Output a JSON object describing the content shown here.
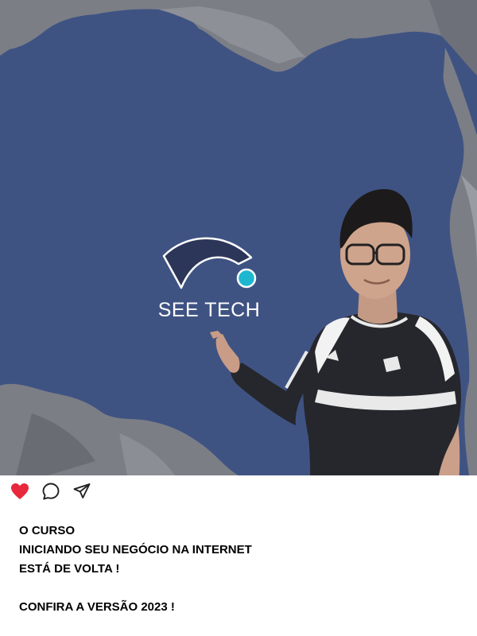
{
  "post": {
    "brand": {
      "name": "SEE TECH",
      "accent": "#1eb7cf",
      "mark_color": "#2c3658"
    },
    "actions": [
      {
        "name": "like-button",
        "icon": "heart-icon",
        "liked": true,
        "color": "#e8283c"
      },
      {
        "name": "comment-button",
        "icon": "comment-icon"
      },
      {
        "name": "share-button",
        "icon": "send-icon"
      }
    ],
    "caption": {
      "line1": "O CURSO",
      "line2": "INICIANDO SEU NEGÓCIO NA INTERNET",
      "line3": "ESTÁ DE VOLTA !",
      "line4": "CONFIRA A VERSÃO 2023 !"
    },
    "colors": {
      "backdrop": "#3f5383",
      "rock": "#7c7e86",
      "caption_text": "#000000"
    }
  }
}
